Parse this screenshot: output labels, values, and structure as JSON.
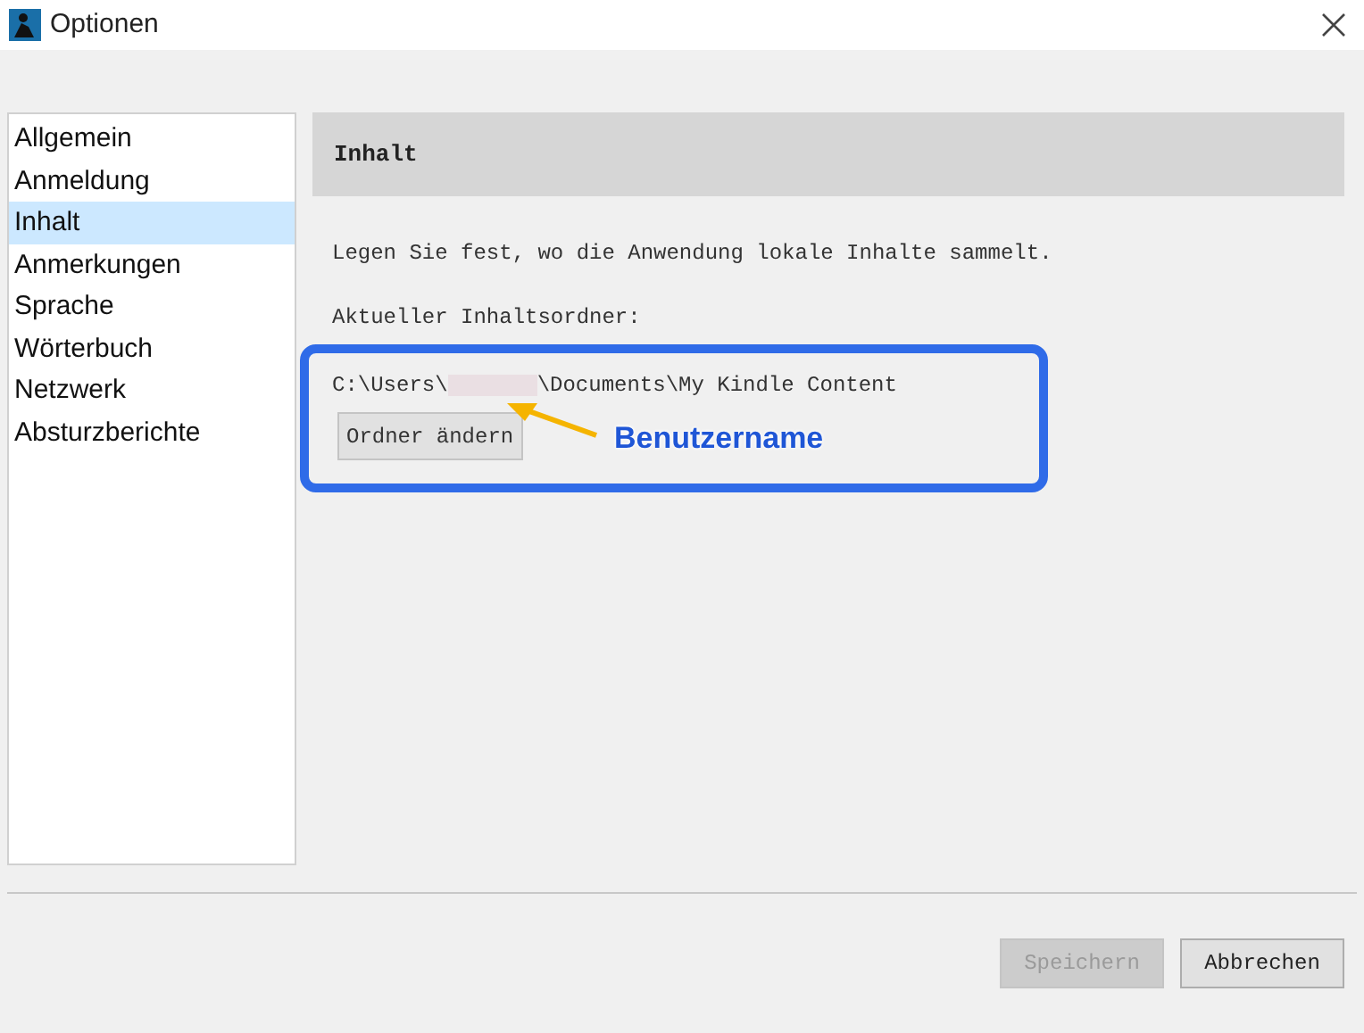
{
  "window": {
    "title": "Optionen"
  },
  "sidebar": {
    "items": [
      {
        "label": "Allgemein",
        "selected": false
      },
      {
        "label": "Anmeldung",
        "selected": false
      },
      {
        "label": "Inhalt",
        "selected": true
      },
      {
        "label": "Anmerkungen",
        "selected": false
      },
      {
        "label": "Sprache",
        "selected": false
      },
      {
        "label": "Wörterbuch",
        "selected": false
      },
      {
        "label": "Netzwerk",
        "selected": false
      },
      {
        "label": "Absturzberichte",
        "selected": false
      }
    ]
  },
  "panel": {
    "heading": "Inhalt",
    "description": "Legen Sie fest, wo die Anwendung lokale Inhalte sammelt.",
    "folder_label": "Aktueller Inhaltsordner:",
    "path_prefix": "C:\\Users\\",
    "path_suffix": "\\Documents\\My Kindle Content",
    "change_button": "Ordner ändern"
  },
  "annotation": {
    "label": "Benutzername"
  },
  "buttons": [
    {
      "label": "Speichern",
      "disabled": true
    },
    {
      "label": "Abbrechen",
      "disabled": false
    }
  ]
}
